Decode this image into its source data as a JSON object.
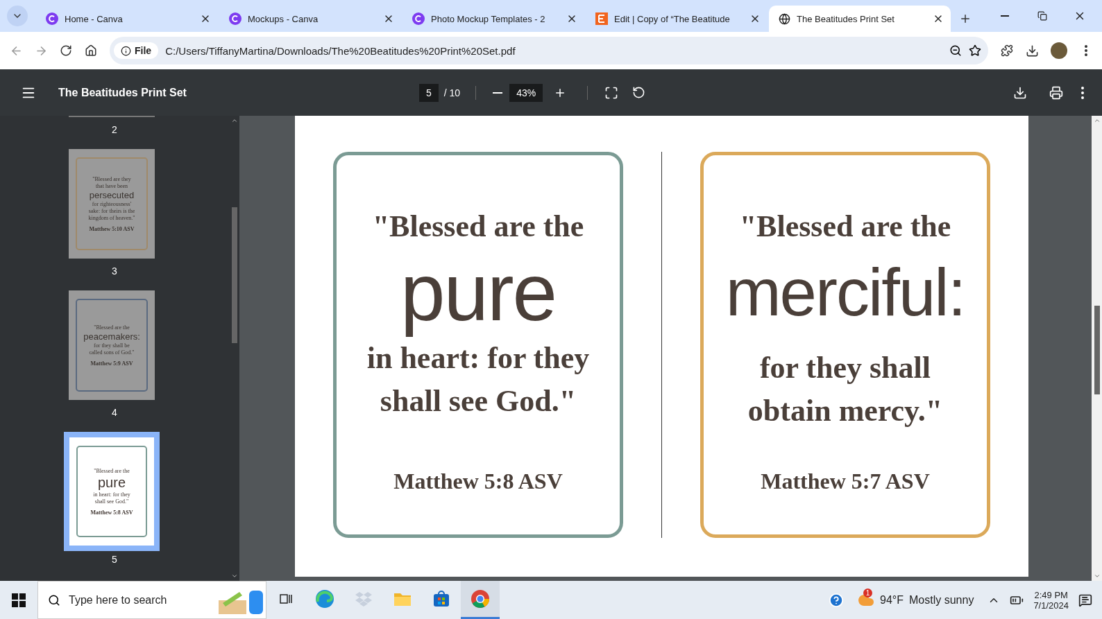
{
  "browser": {
    "tabs": [
      {
        "title": "Home - Canva",
        "kind": "canva",
        "selected": false
      },
      {
        "title": "Mockups - Canva",
        "kind": "canva",
        "selected": false
      },
      {
        "title": "Photo Mockup Templates - 2",
        "kind": "canva",
        "selected": false
      },
      {
        "title": "Edit | Copy of “The Beatitude",
        "kind": "etsy",
        "selected": false
      },
      {
        "title": "The Beatitudes Print Set",
        "kind": "globe",
        "selected": true
      }
    ],
    "address": {
      "scheme": "File",
      "url": "C:/Users/TiffanyMartina/Downloads/The%20Beatitudes%20Print%20Set.pdf"
    }
  },
  "viewer": {
    "title": "The Beatitudes Print Set",
    "page": "5",
    "page_count": "/ 10",
    "zoom": "43%"
  },
  "sidebar": {
    "top_label": "2",
    "thumbnails": [
      {
        "label": "3",
        "selected": false,
        "color": "#a08a6a",
        "lines": [
          "\"Blessed are they",
          "that have been"
        ],
        "keyword": "persecuted",
        "rest": [
          "for righteousness'",
          "sake: for theirs is the",
          "kingdom of heaven.\""
        ],
        "reference": "Matthew 5:10 ASV"
      },
      {
        "label": "4",
        "selected": false,
        "color": "#5a6a80",
        "lines": [
          "\"Blessed are the"
        ],
        "keyword": "peacemakers:",
        "rest": [
          "for they shall be",
          "called sons of God.\""
        ],
        "reference": "Matthew 5:9 ASV"
      },
      {
        "label": "5",
        "selected": true,
        "color": "#7b9b94",
        "lines": [
          "\"Blessed are the"
        ],
        "keyword": "pure",
        "rest": [
          "in heart: for they",
          "shall see God.\""
        ],
        "reference": "Matthew 5:8 ASV"
      }
    ]
  },
  "pages": [
    {
      "color": "#7b9b94",
      "lines": [
        "\"Blessed are the"
      ],
      "keyword": "pure",
      "rest": [
        "in heart: for they",
        "shall see God.\""
      ],
      "reference": "Matthew 5:8 ASV"
    },
    {
      "color": "#dba95a",
      "lines": [
        "\"Blessed are the"
      ],
      "keyword": "merciful:",
      "rest": [
        "for they shall",
        "obtain mercy.\""
      ],
      "reference": "Matthew 5:7 ASV"
    }
  ],
  "taskbar": {
    "search_placeholder": "Type here to search",
    "apps": [
      {
        "kind": "taskview",
        "selected": false
      },
      {
        "kind": "edge",
        "selected": false
      },
      {
        "kind": "dropbox",
        "selected": false
      },
      {
        "kind": "folder",
        "selected": false
      },
      {
        "kind": "store",
        "selected": false
      },
      {
        "kind": "chrome",
        "selected": true
      }
    ],
    "weather": {
      "badge": "1",
      "temp": "94°F",
      "text": "Mostly sunny"
    },
    "time": "2:49 PM",
    "date": "7/1/2024"
  }
}
